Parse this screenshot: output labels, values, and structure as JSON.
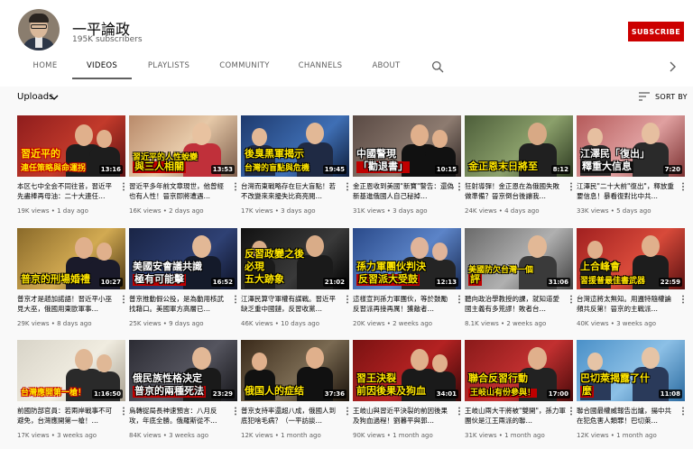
{
  "channel": {
    "name": "一平論政",
    "subscribers": "195K subscribers",
    "subscribe_label": "SUBSCRIBE"
  },
  "tabs": [
    {
      "label": "HOME",
      "active": false
    },
    {
      "label": "VIDEOS",
      "active": true
    },
    {
      "label": "PLAYLISTS",
      "active": false
    },
    {
      "label": "COMMUNITY",
      "active": false
    },
    {
      "label": "CHANNELS",
      "active": false
    },
    {
      "label": "ABOUT",
      "active": false
    }
  ],
  "icons": {
    "search": "search-icon",
    "next": "chevron-right-icon",
    "sort": "sort-icon",
    "uploads_dropdown": "chevron-down-icon",
    "more": "more-vert-icon"
  },
  "uploads_label": "Uploads",
  "sort_label": "SORT BY",
  "colors": {
    "subscribe": "#cc0000",
    "caption_yellow": "#ffe600",
    "caption_red": "#ff2020",
    "meta_text": "#606060"
  },
  "videos": [
    {
      "title": "本区七中全会不同往昔，習近平先盡棒再母油：二十大連任…",
      "views": "19K views",
      "age": "1 day ago",
      "duration": "13:16",
      "caption": [
        "習近平的",
        "連任策略與命運拐"
      ],
      "theme": "red"
    },
    {
      "title": "習近平多年前文章現世，他曾經也有人性！晉京即將遭遇…",
      "views": "16K views",
      "age": "2 days ago",
      "duration": "13:53",
      "caption": [
        "習近平的人性蛻變",
        "與三人相關"
      ],
      "theme": "warm"
    },
    {
      "title": "台灣而東戰略存在巨大盲點！若不改變來來擾失比商亮閱…",
      "views": "17K views",
      "age": "3 days ago",
      "duration": "19:45",
      "caption": [
        "後臭黑軍揭示",
        "台灣的盲點與危機"
      ],
      "theme": "blue"
    },
    {
      "title": "金正恩收到美國\"新寶\"警告：還偽新基進俄國人自己秘掉…",
      "views": "31K views",
      "age": "3 days ago",
      "duration": "10:15",
      "caption": [
        "中國警現",
        "「勸退書」"
      ],
      "theme": "dark"
    },
    {
      "title": "狂射導彈！金正恩在為俄國失敗做準備？晉京倒台後讓我…",
      "views": "24K views",
      "age": "4 days ago",
      "duration": "8:12",
      "caption": [
        "金正恩末日將至"
      ],
      "theme": "green"
    },
    {
      "title": "江澤民\"二十大前\"復出\"，釋放重要信息！暴看復對比中共…",
      "views": "33K views",
      "age": "5 days ago",
      "duration": "7:20",
      "caption": [
        "江澤民「復出」",
        "釋重大信息"
      ],
      "theme": "rose"
    },
    {
      "title": "普京才是趙加諾語！習近平小巫見大巫，俄國用東歐軍事…",
      "views": "29K views",
      "age": "8 days ago",
      "duration": "10:27",
      "caption": [
        "普京的刑場婚禮"
      ],
      "theme": "gold"
    },
    {
      "title": "普京推動假公投，是為動用核武找藉口。美國軍方高層已…",
      "views": "25K views",
      "age": "9 days ago",
      "duration": "16:52",
      "caption": [
        "美國安會議共識",
        "極有可能擊"
      ],
      "theme": "navy"
    },
    {
      "title": "江澤民算守軍權有謀戰。習近平缺乏重中國鏈，反習收黨…",
      "views": "46K views",
      "age": "10 days ago",
      "duration": "21:02",
      "caption": [
        "反習政變之後",
        "必現",
        "五大跡象"
      ],
      "theme": "black"
    },
    {
      "title": "這樣宣判孫力軍團伙，等於鼓勵反習派再接再厲！獲敵者…",
      "views": "20K views",
      "age": "2 weeks ago",
      "duration": "12:13",
      "caption": [
        "孫力軍團伙判決",
        "反習派大受鼓"
      ],
      "theme": "blue2"
    },
    {
      "title": "聽向政治學教授的課，就知道愛國主義有多荒謬！敗者台…",
      "views": "8.1K views",
      "age": "2 weeks ago",
      "duration": "31:06",
      "caption": [
        "美國防欠台灣一個",
        "評"
      ],
      "theme": "grey"
    },
    {
      "title": "台灣這將太無知。用邏特隨權論頻共反第！晉京的主戰派…",
      "views": "40K views",
      "age": "3 weeks ago",
      "duration": "22:59",
      "caption": [
        "上合峰會",
        "習援普最佳書武器"
      ],
      "theme": "red2"
    },
    {
      "title": "前國防部官員：若兩岸戰事不可避免，台灣應開第一槍！…",
      "views": "17K views",
      "age": "3 weeks ago",
      "duration": "1:16:50",
      "caption": [
        "台灣應開第一槍！"
      ],
      "theme": "light"
    },
    {
      "title": "烏轉捉局長神速預言：八月反攻，年底全勝。俄羅斯從不…",
      "views": "84K views",
      "age": "3 weeks ago",
      "duration": "23:29",
      "caption": [
        "俄民族性格決定",
        "普京的兩種死法"
      ],
      "theme": "dark2"
    },
    {
      "title": "普京支持率還超八成，俄國人到底犯啥毛病？（一平訪談…",
      "views": "12K views",
      "age": "1 month ago",
      "duration": "37:36",
      "caption": [
        "俄国人的症结"
      ],
      "theme": "gala"
    },
    {
      "title": "王岐山與習近平決裂的前因後果及狗血過程！劉暮平與郭…",
      "views": "90K views",
      "age": "1 month ago",
      "duration": "34:01",
      "caption": [
        "習王決裂",
        "前因後果及狗血"
      ],
      "theme": "red3"
    },
    {
      "title": "王岐山兩大干將被\"雙開\"，孫力軍團伙是江王兩派的聯…",
      "views": "31K views",
      "age": "1 month ago",
      "duration": "17:00",
      "caption": [
        "聯合反習行動",
        "王岐山有份參與！"
      ],
      "theme": "red4"
    },
    {
      "title": "聯合國最權威報告出爐，揚中共在犯危害人類罪！巴切萊…",
      "views": "12K views",
      "age": "1 month ago",
      "duration": "11:08",
      "caption": [
        "巴切萊揭露了什",
        "麼"
      ],
      "theme": "un"
    }
  ]
}
